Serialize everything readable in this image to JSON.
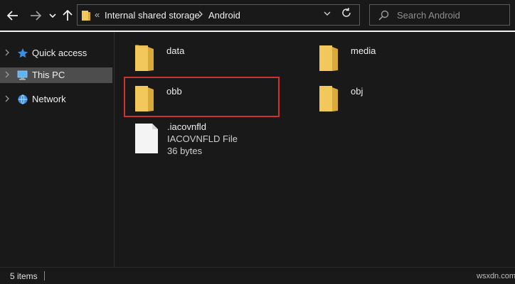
{
  "toolbar": {
    "back_icon": "arrow-left-icon",
    "forward_icon": "arrow-right-icon",
    "recent_icon": "chevron-down-icon",
    "up_icon": "arrow-up-icon"
  },
  "address_bar": {
    "overflow": "«",
    "crumbs": [
      "Internal shared storage",
      "Android"
    ],
    "dropdown_icon": "chevron-down-icon",
    "refresh_icon": "refresh-icon"
  },
  "search": {
    "placeholder": "Search Android"
  },
  "sidebar": {
    "items": [
      {
        "label": "Quick access",
        "icon": "star-icon"
      },
      {
        "label": "This PC",
        "icon": "computer-icon",
        "selected": true
      },
      {
        "label": "Network",
        "icon": "network-icon"
      }
    ]
  },
  "files": [
    {
      "name": "data",
      "type": "folder"
    },
    {
      "name": "media",
      "type": "folder"
    },
    {
      "name": "obb",
      "type": "folder",
      "highlighted": true
    },
    {
      "name": "obj",
      "type": "folder"
    },
    {
      "name": ".iacovnfld",
      "type": "file",
      "kind": "IACOVNFLD File",
      "size": "36 bytes"
    }
  ],
  "status": {
    "item_count": "5 items",
    "watermark": "wsxdn.com"
  },
  "colors": {
    "background": "#191919",
    "selection": "#4d4d4d",
    "highlight_border": "#d32f2f",
    "folder": "#f2c75c"
  }
}
